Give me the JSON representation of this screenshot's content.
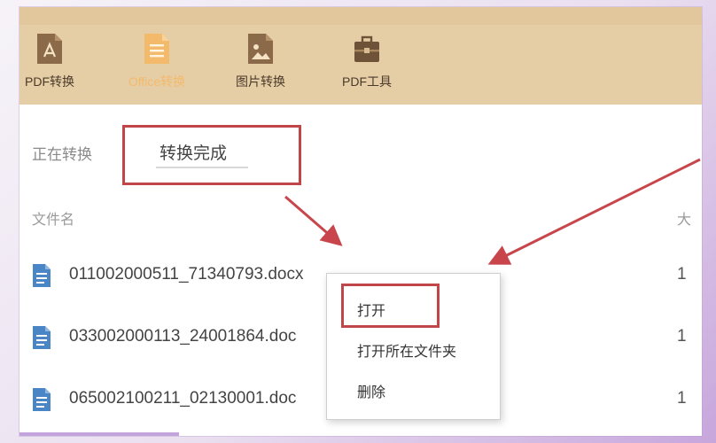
{
  "toolbar": {
    "items": [
      {
        "label": "PDF转换",
        "icon": "pdf-icon"
      },
      {
        "label": "Office转换",
        "icon": "office-document-icon"
      },
      {
        "label": "图片转换",
        "icon": "image-icon"
      },
      {
        "label": "PDF工具",
        "icon": "toolbox-icon"
      }
    ],
    "active_index": 1
  },
  "tabs": {
    "converting": "正在转换",
    "done": "转换完成"
  },
  "table": {
    "headers": {
      "name": "文件名",
      "size": "大"
    },
    "rows": [
      {
        "name": "011002000511_71340793.docx",
        "size": "1"
      },
      {
        "name": "033002000113_24001864.doc",
        "size": "1"
      },
      {
        "name": "065002100211_02130001.doc",
        "size": "1"
      }
    ]
  },
  "context_menu": {
    "items": [
      "打开",
      "打开所在文件夹",
      "删除"
    ],
    "highlighted_index": 0
  },
  "colors": {
    "toolbar_bg": "#e5cda5",
    "accent_active": "#f4ba6b",
    "annotation_red": "#c0464a",
    "file_icon_blue": "#4a86c6"
  }
}
